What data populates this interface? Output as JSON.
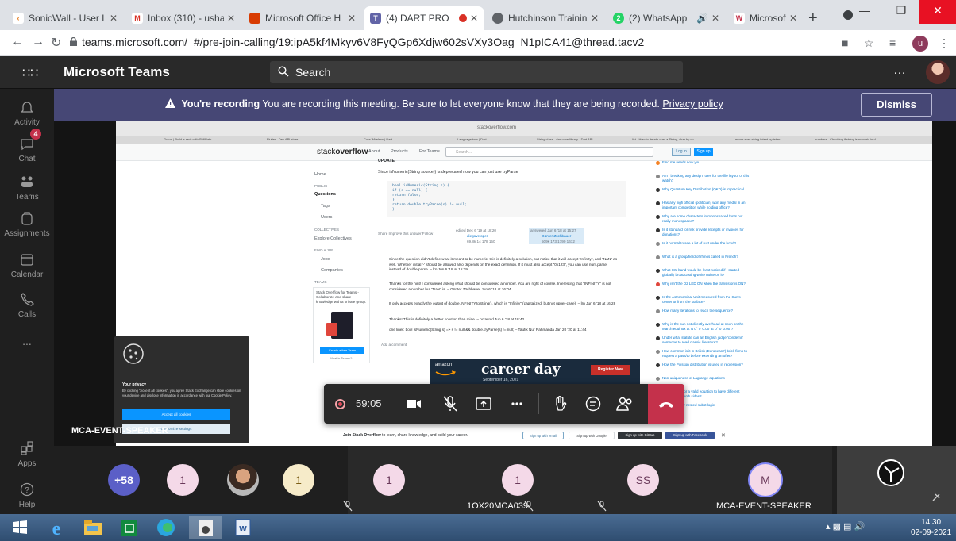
{
  "browser": {
    "tabs": [
      {
        "label": "SonicWall - User L",
        "fav_color": "#e67e22",
        "fav_glyph": "C"
      },
      {
        "label": "Inbox (310) - usha",
        "fav_color": "#ffffff",
        "fav_glyph": "M"
      },
      {
        "label": "Microsoft Office H",
        "fav_color": "#d83b01",
        "fav_glyph": ""
      },
      {
        "label": "(4) DART PRO",
        "fav_color": "#6264a7",
        "fav_glyph": ""
      },
      {
        "label": "Hutchinson Trainin",
        "fav_color": "#555555",
        "fav_glyph": ""
      },
      {
        "label": "(2) WhatsApp",
        "fav_color": "#25d366",
        "fav_glyph": "2"
      },
      {
        "label": "Microsoft Teams",
        "fav_color": "#f0c419",
        "fav_glyph": "W"
      }
    ],
    "url": "teams.microsoft.com/_#/pre-join-calling/19:ipA5kf4Mkyv6V8FyQGp6Xdjw602sVXy3Oag_N1pICA41@thread.tacv2",
    "profile_initial": "u"
  },
  "teams": {
    "title": "Microsoft Teams",
    "search_placeholder": "Search",
    "rail": [
      "Activity",
      "Chat",
      "Teams",
      "Assignments",
      "Calendar",
      "Calls",
      "...",
      "Apps",
      "Help"
    ],
    "chat_badge": "4"
  },
  "banner": {
    "bold": "You're recording",
    "text": " You are recording this meeting. Be sure to let everyone know that they are being recorded. ",
    "link": "Privacy policy",
    "dismiss": "Dismiss"
  },
  "shared": {
    "url": "stackoverflow.com",
    "bookmarks": [
      "Gurun | Build a rank with SkillPath",
      "Flutter - Dev API store",
      "Core Wireless | Dart",
      "Language tour | Dart",
      "String class - dart:core library - Dart API",
      "list - How to iterate over a String, char by ch...",
      "errors ever string intent by letter",
      "numbers - Checking if string is numeric in d..."
    ],
    "logo_pre": "stack",
    "logo_bold": "overflow",
    "nav": [
      "About",
      "Products",
      "For Teams"
    ],
    "search_placeholder": "Search...",
    "login": "Log in",
    "signup": "Sign up",
    "left_nav": [
      {
        "label": "Home",
        "cls": ""
      },
      {
        "label": "PUBLIC",
        "cls": "sec"
      },
      {
        "label": "Questions",
        "cls": "active"
      },
      {
        "label": "Tags",
        "cls": ""
      },
      {
        "label": "Users",
        "cls": ""
      },
      {
        "label": "COLLECTIVES",
        "cls": "sec"
      },
      {
        "label": "Explore Collectives",
        "cls": ""
      },
      {
        "label": "FIND A JOB",
        "cls": "sec"
      },
      {
        "label": "Jobs",
        "cls": ""
      },
      {
        "label": "Companies",
        "cls": ""
      },
      {
        "label": "TEAMS",
        "cls": "sec"
      }
    ],
    "teams_box_text": "Stack Overflow for Teams - Collaborate and share knowledge with a private group.",
    "teams_btn": "Create a free Team",
    "teams_what": "What is Teams?",
    "update": "UPDATE",
    "since": "Since  isNumeric(String source))  is deprecated now you can just use  tryParse",
    "code": [
      "bool isNumeric(String s) {",
      "  if (s == null) {",
      "    return false;",
      "  }",
      "  return double.tryParse(s) != null;",
      "}"
    ],
    "share": "Share  Improve this answer  Follow",
    "edited": "edited Dec 6 '19 at 18:20",
    "editor": "diegoveloper",
    "editor_rep": "69.8k  14  178  150",
    "answered": "answered Jun 6 '18 at 15:27",
    "author": "Günter Zöchbauer",
    "author_rep": "509k  173  1790  1612",
    "comments": [
      "Since the question didn't define what it meant to be numeric, this is definitely a solution, but notice that it will accept \"Infinity\", and \"NaN\" as well. Whether initial '-' should be allowed also depends on the exact definition. If it must also accept \"0x123\", you can use num.parse instead of double.parse. – lrn Jun 6 '18 at 15:29",
      "Thanks for the hint! I considered asking what should be considered a number. You are right of course. Interesting that \"INFINITY\" is not considered a number but \"NaN\" is. – Günter Zöchbauer Jun 6 '18 at 16:04",
      "It only accepts exactly the output of double.INFINITY.toString(), which is \"Infinity\" (capitalized, but not upper-case). – lrn Jun 6 '18 at 16:28",
      "Thanks! This is definitely a better solution than mine. – octavoid Jun 6 '18 at 18:42",
      "one liner: bool isNumeric(String s) => s != null && double.tryParse(s) != null; – Taufik Nur Rahmanda Jan 20 '20 at 11:44"
    ],
    "add_comment": "Add a comment",
    "right": [
      {
        "label": "Find me needs now you",
        "color": "#f48225"
      },
      {
        "label": "Am I breaking any design rules for the file layout of this watch?",
        "color": "#888888"
      },
      {
        "label": "Why Quantum Key Distribution (QKD) is impractical",
        "color": "#333333"
      },
      {
        "label": "Has any high official (politician) won any medal in an important competition while holding office?",
        "color": "#333333"
      },
      {
        "label": "Why are some characters in monospaced fonts not really monospaced?",
        "color": "#333333"
      },
      {
        "label": "Is it standard for risk provide receipts or invoices for donations?",
        "color": "#333333"
      },
      {
        "label": "Is it normal to see a lot of rust under the hood?",
        "color": "#888888"
      },
      {
        "label": "What is a group/herd of rhinos called in French?",
        "color": "#888888"
      },
      {
        "label": "What SW band would be least noticed if I started globally broadcasting white noise on it?",
        "color": "#333333"
      },
      {
        "label": "Why isn't the D2 LED ON when the transistor is ON?",
        "color": "#e0453b"
      },
      {
        "label": "Is the Astronomical Unit measured from the Sun's center or from the surface?",
        "color": "#333333"
      },
      {
        "label": "How many iterations to reach the sequence?",
        "color": "#888888"
      },
      {
        "label": "Why is the sun not directly overhead at noon on the March equinox at N 0° 0' 0.00\" E 0° 0' 0.00\"?",
        "color": "#333333"
      },
      {
        "label": "Under what statute can an English judge 'condemn' someone to read classic literature?",
        "color": "#333333"
      },
      {
        "label": "How common is it in British (European?) brick firms to request a pass/to before extending an offer?",
        "color": "#888888"
      },
      {
        "label": "How the Poisson distribution is used in regression?",
        "color": "#333333"
      },
      {
        "label": "Non-uniqueness of Lagrange equations",
        "color": "#888888"
      },
      {
        "label": "Is it possible for a valid equation to have different dimension in both sides?",
        "color": "#888888"
      },
      {
        "label": "Remove oddly nested subst logic",
        "color": "#888888"
      }
    ],
    "ad_brand": "amazon",
    "ad_title": "career day",
    "ad_date": "September 16, 2021",
    "ad_button": "Register Now",
    "footer_lead": "Join Stack Overflow",
    "footer_rest": " to learn, share knowledge, and build your career.",
    "footer_email": "Sign up with email",
    "footer_google": "Sign up with Google",
    "footer_github": "Sign up with GitHub",
    "footer_facebook": "Sign up with Facebook",
    "instead": "instead, use",
    "cookie_title": "Your privacy",
    "cookie_text": "By clicking \"Accept all cookies\", you agree Stack Exchange can store cookies on your device and disclose information in accordance with our Cookie Policy.",
    "cookie_accept": "Accept all cookies",
    "cookie_customize": "Customize settings"
  },
  "meeting": {
    "presenter": "MCA-EVENT-SPEAKER",
    "timer": "59:05",
    "participants": [
      {
        "initials": "+58",
        "bg": "#5b5fc7",
        "fg": "#ffffff",
        "name": ""
      },
      {
        "initials": "1",
        "bg": "#f4d9e8",
        "fg": "#6b3a5b",
        "name": ""
      },
      {
        "initials": "",
        "bg": "#8a7a6a",
        "fg": "#ffffff",
        "name": ""
      },
      {
        "initials": "1",
        "bg": "#f6ebc9",
        "fg": "#7a5c14",
        "name": ""
      },
      {
        "initials": "1",
        "bg": "#f4d9e8",
        "fg": "#6b3a5b",
        "name": ""
      },
      {
        "initials": "1",
        "bg": "#f4d9e8",
        "fg": "#6b3a5b",
        "name": "1OX20MCA039"
      },
      {
        "initials": "SS",
        "bg": "#f4d9e8",
        "fg": "#6b3a5b",
        "name": ""
      },
      {
        "initials": "M",
        "bg": "#f4d9e8",
        "fg": "#6b3a5b",
        "name": "MCA-EVENT-SPEAKER"
      }
    ]
  },
  "taskbar": {
    "time": "14:30",
    "date": "02-09-2021"
  }
}
